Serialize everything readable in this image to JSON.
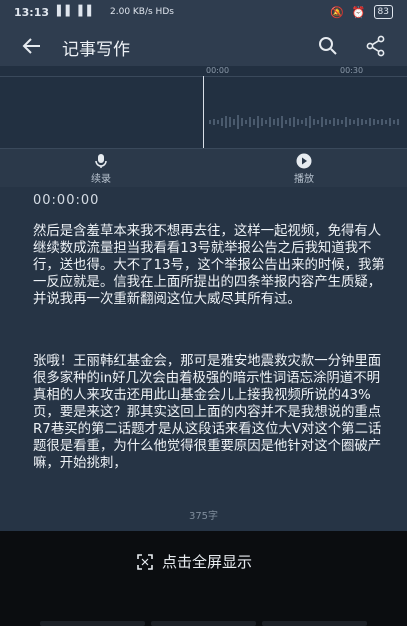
{
  "status_bar": {
    "time": "13:13",
    "signal": "▐▐ ▐▐",
    "network": "2.00 KB/s HDs",
    "battery": "83"
  },
  "app_bar": {
    "title": "记事写作"
  },
  "waveform": {
    "ticks": [
      "00:00",
      "00:30"
    ]
  },
  "controls": {
    "record_label": "续录",
    "play_label": "播放"
  },
  "content": {
    "timestamp": "00:00:00",
    "paragraph1": "然后是含羞草本来我不想再去往，这样一起视频，免得有人继续数成流量担当我看看13号就举报公告之后我知道我不行，送也得。大不了13号，这个举报公告出来的时候，我第一反应就是。信我在上面所提出的四条举报内容产生质疑，并说我再一次重新翻阅这位大威尽其所有过。",
    "paragraph2": "张哦！王丽韩红基金会，那可是雅安地震救灾款一分钟里面很多家种的in好几次会由着极强的暗示性词语忘涂阴道不明真相的人来攻击还用此山基金会儿上接我视频所说的43%页，要是来这？那其实这回上面的内容并不是我想说的重点R7巷买的第二话题才是从这段话来看这位大V对这个第二话题很是看重，为什么他觉得很重要原因是他针对这个圈破产嘛，开始挑刺，",
    "char_count": "375字"
  },
  "bottom": {
    "fullscreen_label": "点击全屏显示"
  }
}
